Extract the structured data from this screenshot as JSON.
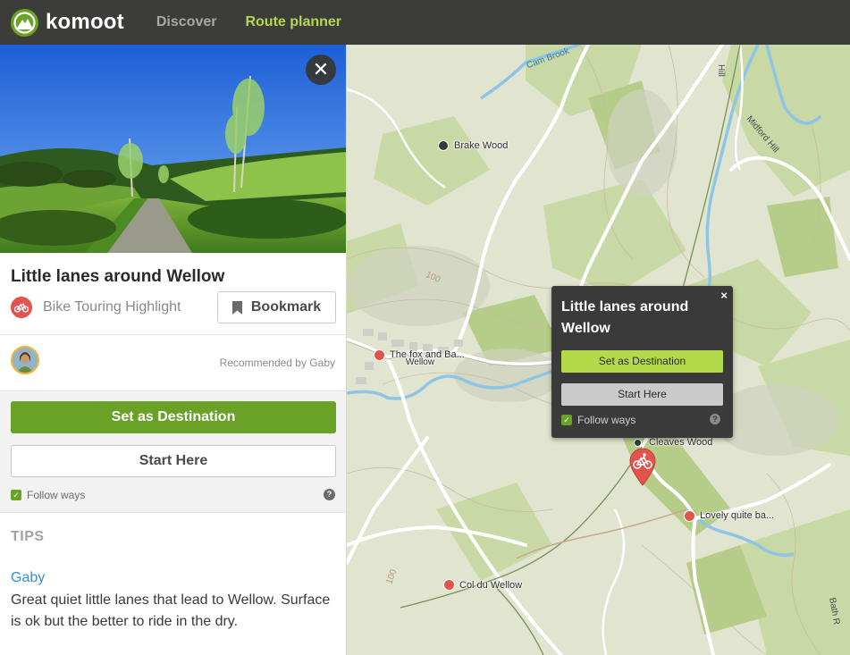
{
  "app": {
    "logo_text": "komoot",
    "nav": [
      {
        "label": "Discover"
      },
      {
        "label": "Route planner"
      }
    ]
  },
  "sidebar": {
    "close_symbol": "✕",
    "title": "Little lanes around Wellow",
    "type_label": "Bike Touring Highlight",
    "bookmark_label": "Bookmark",
    "recommended_by": "Recommended by Gaby",
    "set_destination_label": "Set as Destination",
    "start_here_label": "Start Here",
    "follow_ways_label": "Follow ways",
    "follow_ways_checked": true,
    "help_symbol": "?",
    "tips_heading": "TIPS",
    "tip": {
      "author": "Gaby",
      "text": "Great quiet little lanes that lead to Wellow. Surface is ok but the better to ride in the dry."
    }
  },
  "map": {
    "labels": {
      "brake_wood": "Brake Wood",
      "fox": "The fox and Ba...",
      "wellow": "Wellow",
      "cleaves_wood": "Cleaves Wood",
      "lovely": "Lovely quite ba...",
      "col_du_wellow": "Col du Wellow",
      "cam_brook": "Cam Brook",
      "midford_hill": "Midford Hill",
      "hill_top": "Hill",
      "bath_rd": "Bath R",
      "contour_100": "100"
    },
    "popup": {
      "close_symbol": "×",
      "title": "Little lanes around Wellow",
      "set_destination_label": "Set as Destination",
      "start_here_label": "Start Here",
      "follow_ways_label": "Follow ways",
      "help_symbol": "?"
    }
  },
  "colors": {
    "topbar": "#3c3c3b",
    "brand_green": "#6aa127",
    "nav_active": "#b4d94b",
    "highlight_red": "#e2534e",
    "link_blue": "#2e8fd6"
  },
  "icons": [
    "komoot-logo-icon",
    "close-icon",
    "bike-icon",
    "bookmark-icon",
    "checkbox-icon",
    "help-icon",
    "map-pin-icon",
    "tree-icon",
    "collapse-arrow-icon"
  ]
}
